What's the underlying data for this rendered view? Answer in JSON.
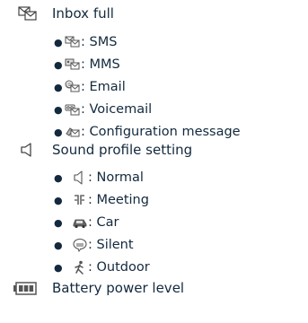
{
  "inbox": {
    "heading": "Inbox full",
    "icon": "inbox-full-icon",
    "items": [
      {
        "icon": "sms-inbox-full-icon",
        "label": ": SMS"
      },
      {
        "icon": "mms-inbox-full-icon",
        "label": ": MMS"
      },
      {
        "icon": "email-inbox-full-icon",
        "label": ": Email"
      },
      {
        "icon": "voicemail-inbox-full-icon",
        "label": ": Voicemail"
      },
      {
        "icon": "configuration-message-inbox-full-icon",
        "label": ": Configuration message"
      }
    ]
  },
  "sound": {
    "heading": "Sound profile setting",
    "icon": "speaker-icon",
    "items": [
      {
        "icon": "normal-profile-icon",
        "label": ": Normal"
      },
      {
        "icon": "meeting-profile-icon",
        "label": ": Meeting"
      },
      {
        "icon": "car-profile-icon",
        "label": ": Car"
      },
      {
        "icon": "silent-profile-icon",
        "label": ": Silent"
      },
      {
        "icon": "outdoor-profile-icon",
        "label": ": Outdoor"
      }
    ]
  },
  "battery": {
    "heading": "Battery power level",
    "icon": "battery-icon"
  }
}
